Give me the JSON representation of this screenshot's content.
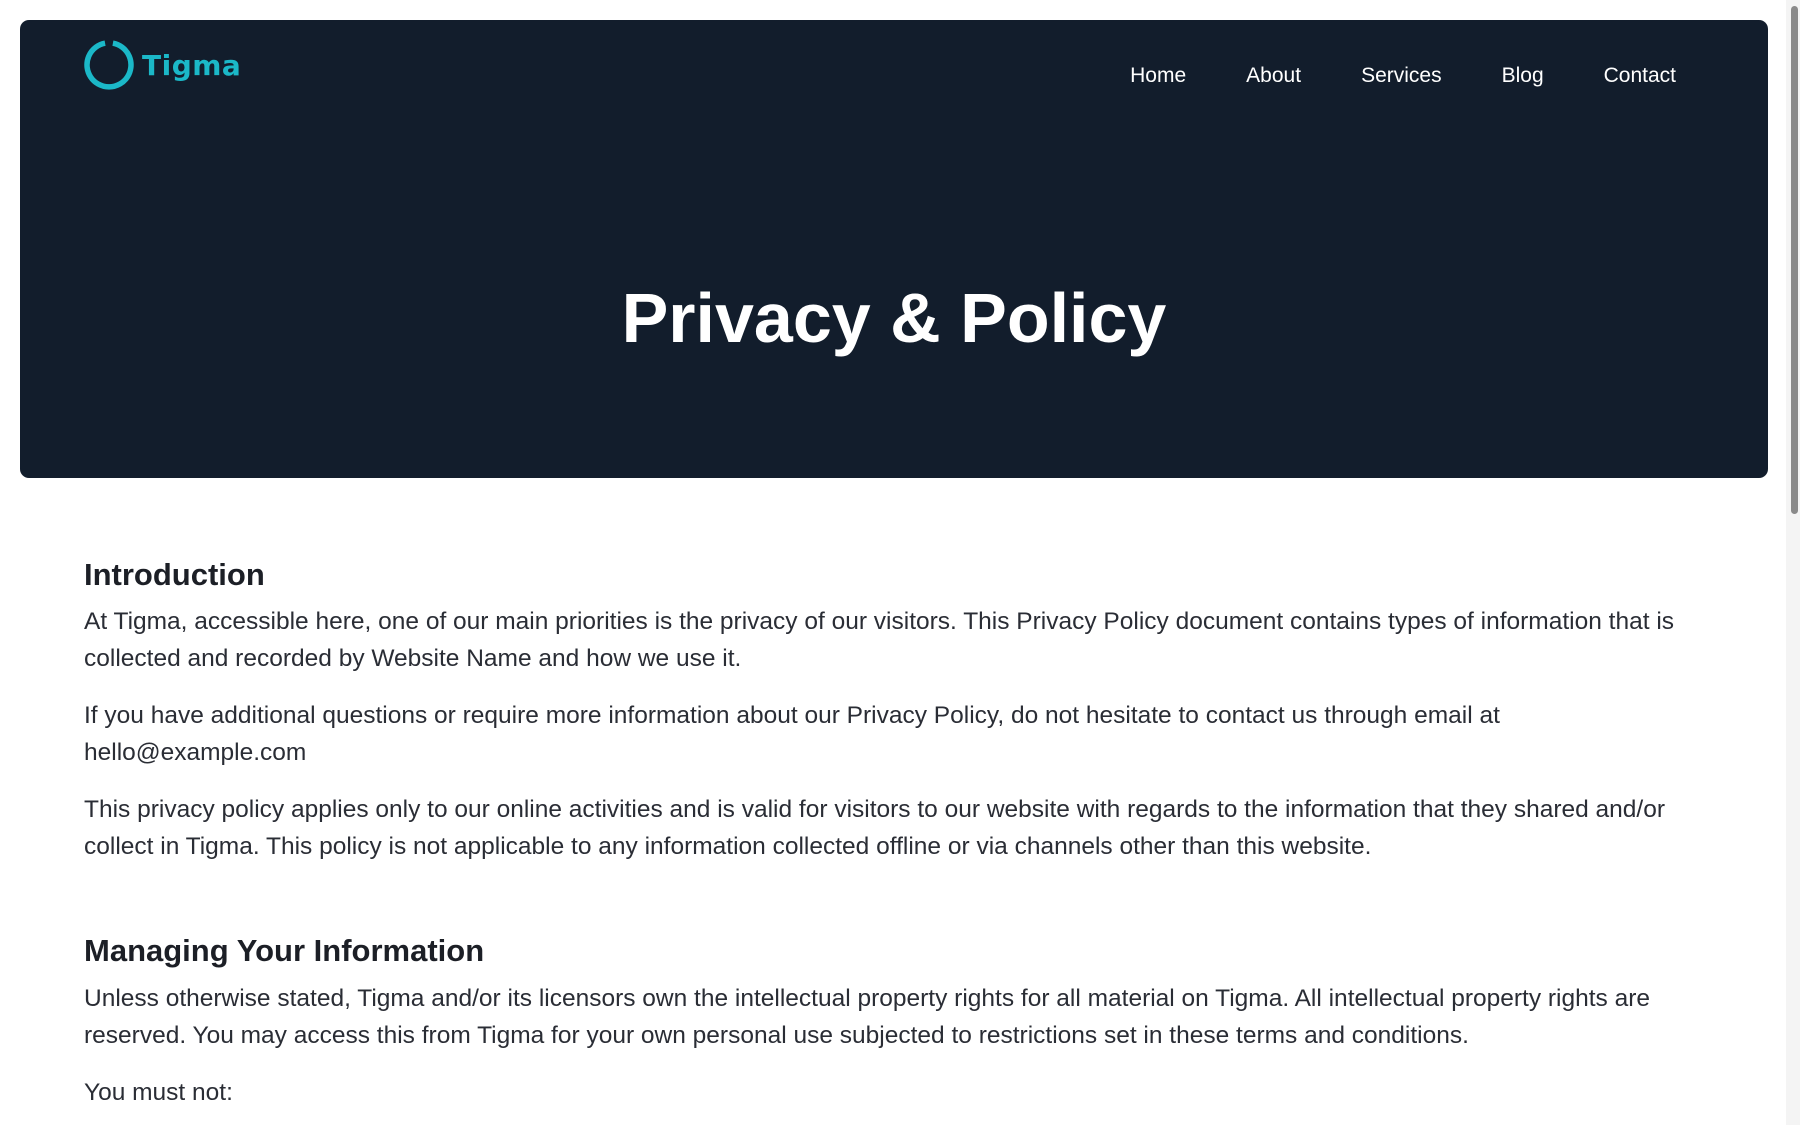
{
  "brand": {
    "name": "Tigma",
    "logo_icon": "ring-logo-icon",
    "accent_color": "#1bb8c8"
  },
  "nav": {
    "items": [
      {
        "label": "Home"
      },
      {
        "label": "About"
      },
      {
        "label": "Services"
      },
      {
        "label": "Blog"
      },
      {
        "label": "Contact"
      }
    ]
  },
  "hero": {
    "title": "Privacy & Policy",
    "background_color": "#121d2c"
  },
  "sections": [
    {
      "heading": "Introduction",
      "paragraphs": [
        "At Tigma, accessible here, one of our main priorities is the privacy of our visitors. This Privacy Policy document contains types of information that is collected and recorded by Website Name and how we use it.",
        "If you have additional questions or require more information about our Privacy Policy, do not hesitate to contact us through email at hello@example.com",
        "This privacy policy applies only to our online activities and is valid for visitors to our website with regards to the information that they shared and/or collect in Tigma. This policy is not applicable to any information collected offline or via channels other than this website."
      ]
    },
    {
      "heading": "Managing Your Information",
      "paragraphs": [
        "Unless otherwise stated, Tigma and/or its licensors own the intellectual property rights for all material on Tigma. All intellectual property rights are reserved. You may access this from Tigma for your own personal use subjected to restrictions set in these terms and conditions.",
        "You must not:"
      ]
    }
  ]
}
